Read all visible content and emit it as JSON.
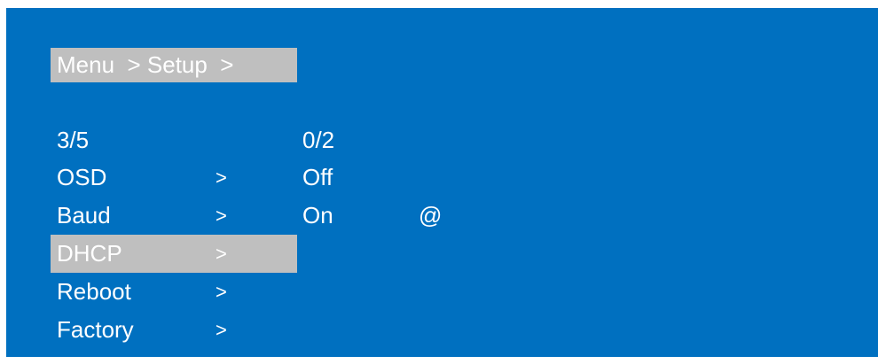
{
  "breadcrumb": "Menu  > Setup  >",
  "menu": {
    "counter": "3/5",
    "items": [
      {
        "label": "OSD",
        "arrow": ">"
      },
      {
        "label": "Baud",
        "arrow": ">"
      },
      {
        "label": "DHCP",
        "arrow": ">"
      },
      {
        "label": "Reboot",
        "arrow": ">"
      },
      {
        "label": "Factory",
        "arrow": ">"
      }
    ],
    "selected_index": 2
  },
  "options": {
    "counter": "0/2",
    "items": [
      {
        "label": "Off",
        "marker": ""
      },
      {
        "label": "On",
        "marker": "@"
      }
    ]
  },
  "colors": {
    "screen_background": "#0070c0",
    "highlight": "#bfbfbf",
    "text": "#ffffff"
  }
}
